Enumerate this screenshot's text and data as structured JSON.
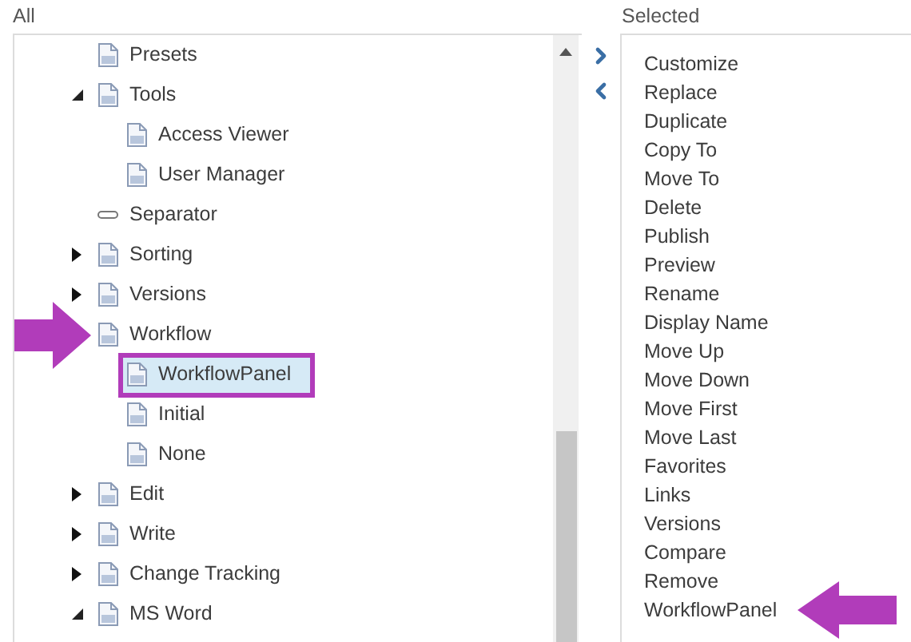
{
  "all_label": "All",
  "tree": [
    {
      "label": "Presets",
      "kind": "item"
    },
    {
      "label": "Tools",
      "kind": "item",
      "expanded": true,
      "children": [
        {
          "label": "Access Viewer",
          "kind": "item"
        },
        {
          "label": "User Manager",
          "kind": "item"
        }
      ]
    },
    {
      "label": "Separator",
      "kind": "separator"
    },
    {
      "label": "Sorting",
      "kind": "item",
      "expanded": false
    },
    {
      "label": "Versions",
      "kind": "item",
      "expanded": false
    },
    {
      "label": "Workflow",
      "kind": "item",
      "pointed": true,
      "children": [
        {
          "label": "WorkflowPanel",
          "kind": "item",
          "selected": true,
          "boxed": true
        },
        {
          "label": "Initial",
          "kind": "item",
          "selected": false,
          "boxed": false
        },
        {
          "label": "None",
          "kind": "item",
          "selected": false,
          "boxed": false
        }
      ]
    },
    {
      "label": "Edit",
      "kind": "item",
      "expanded": false
    },
    {
      "label": "Write",
      "kind": "item",
      "expanded": false
    },
    {
      "label": "Change Tracking",
      "kind": "item",
      "expanded": false
    },
    {
      "label": "MS Word",
      "kind": "item",
      "expanded": true
    }
  ],
  "selected_label": "Selected",
  "selected_items": [
    {
      "label": "Customize"
    },
    {
      "label": "Replace"
    },
    {
      "label": "Duplicate"
    },
    {
      "label": "Copy To"
    },
    {
      "label": "Move To"
    },
    {
      "label": "Delete"
    },
    {
      "label": "Publish"
    },
    {
      "label": "Preview"
    },
    {
      "label": "Rename"
    },
    {
      "label": "Display Name"
    },
    {
      "label": "Move Up"
    },
    {
      "label": "Move Down"
    },
    {
      "label": "Move First"
    },
    {
      "label": "Move Last"
    },
    {
      "label": "Favorites"
    },
    {
      "label": "Links"
    },
    {
      "label": "Versions"
    },
    {
      "label": "Compare"
    },
    {
      "label": "Remove"
    },
    {
      "label": "WorkflowPanel",
      "pointed": true
    }
  ]
}
